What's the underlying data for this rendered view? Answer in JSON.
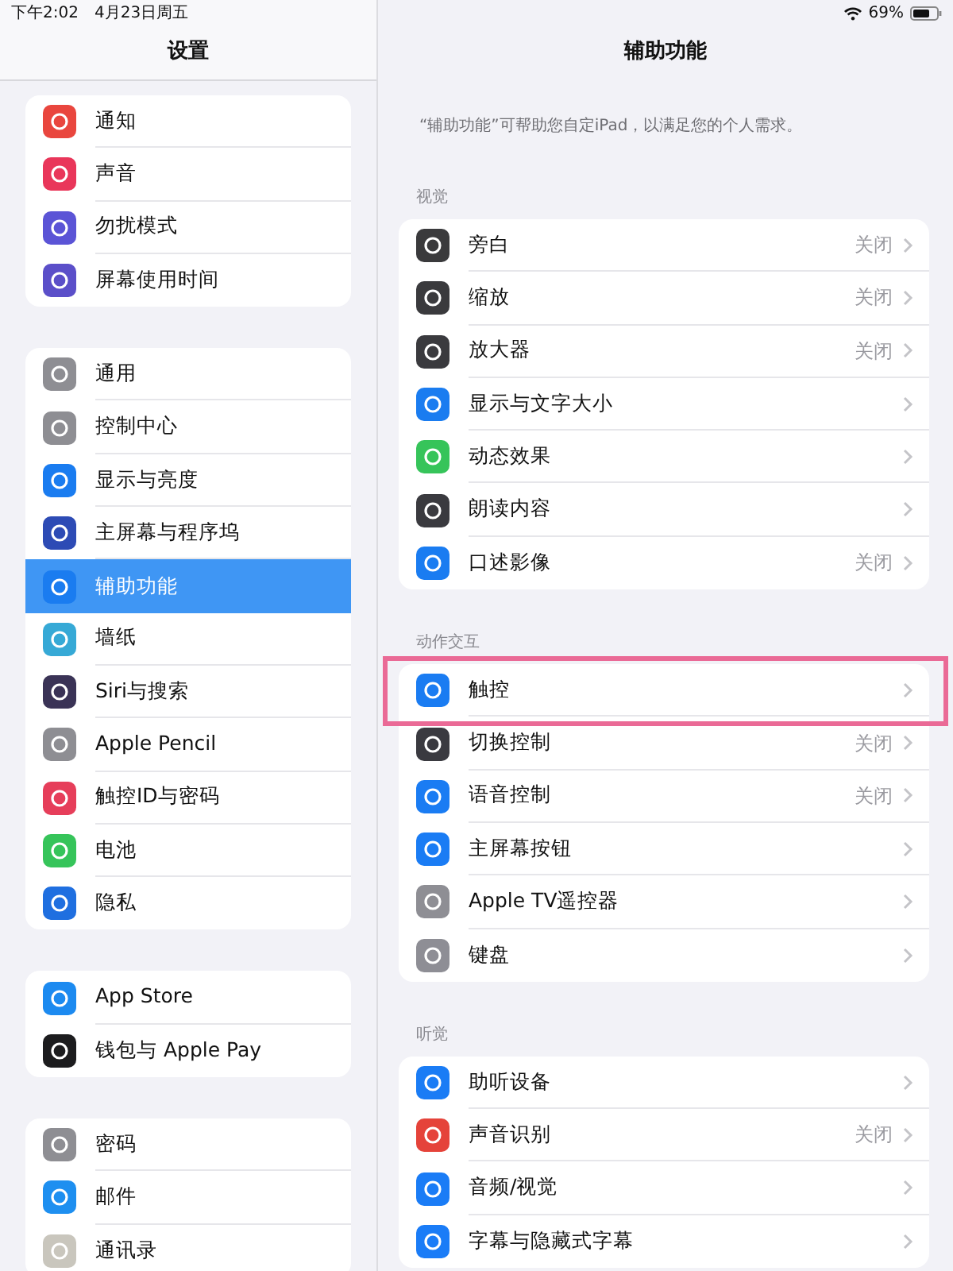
{
  "status_bar": {
    "time": "下午2:02",
    "date": "4月23日周五",
    "battery": "69%"
  },
  "sidebar": {
    "title": "设置",
    "groups": [
      {
        "items": [
          {
            "label": "通知",
            "color": "#e9463e",
            "selected": false
          },
          {
            "label": "声音",
            "color": "#e9365a",
            "selected": false
          },
          {
            "label": "勿扰模式",
            "color": "#5b54d6",
            "selected": false
          },
          {
            "label": "屏幕使用时间",
            "color": "#5b4fc9",
            "selected": false
          }
        ]
      },
      {
        "items": [
          {
            "label": "通用",
            "color": "#8e8e93",
            "selected": false
          },
          {
            "label": "控制中心",
            "color": "#8e8e93",
            "selected": false
          },
          {
            "label": "显示与亮度",
            "color": "#1a7cf0",
            "selected": false
          },
          {
            "label": "主屏幕与程序坞",
            "color": "#2d4bb5",
            "selected": false
          },
          {
            "label": "辅助功能",
            "color": "#1a7cf0",
            "selected": true
          },
          {
            "label": "墙纸",
            "color": "#36a9d6",
            "selected": false
          },
          {
            "label": "Siri与搜索",
            "color": "#3a3356",
            "selected": false
          },
          {
            "label": "Apple Pencil",
            "color": "#8e8e93",
            "selected": false
          },
          {
            "label": "触控ID与密码",
            "color": "#e63e5a",
            "selected": false
          },
          {
            "label": "电池",
            "color": "#36c45a",
            "selected": false
          },
          {
            "label": "隐私",
            "color": "#1f6fe0",
            "selected": false
          }
        ]
      },
      {
        "items": [
          {
            "label": "App Store",
            "color": "#1c8af0",
            "selected": false
          },
          {
            "label": "钱包与 Apple Pay",
            "color": "#1c1c1e",
            "selected": false
          }
        ]
      },
      {
        "items": [
          {
            "label": "密码",
            "color": "#8e8e93",
            "selected": false
          },
          {
            "label": "邮件",
            "color": "#1e8ff0",
            "selected": false
          },
          {
            "label": "通讯录",
            "color": "#c9c6bd",
            "selected": false
          }
        ]
      }
    ]
  },
  "detail": {
    "title": "辅助功能",
    "description": "“辅助功能”可帮助您自定iPad，以满足您的个人需求。",
    "sections": [
      {
        "header": "视觉",
        "items": [
          {
            "label": "旁白",
            "value": "关闭",
            "color": "#3a3a3c",
            "highlighted": false
          },
          {
            "label": "缩放",
            "value": "关闭",
            "color": "#3a3a3d",
            "highlighted": false
          },
          {
            "label": "放大器",
            "value": "关闭",
            "color": "#3a3a3e",
            "highlighted": false
          },
          {
            "label": "显示与文字大小",
            "color": "#1a7cf0",
            "highlighted": false
          },
          {
            "label": "动态效果",
            "color": "#36c45a",
            "highlighted": false
          },
          {
            "label": "朗读内容",
            "color": "#3a3a3f",
            "highlighted": false
          },
          {
            "label": "口述影像",
            "value": "关闭",
            "color": "#1a7cf1",
            "highlighted": false
          }
        ]
      },
      {
        "header": "动作交互",
        "items": [
          {
            "label": "触控",
            "color": "#1a7cf2",
            "highlighted": true
          },
          {
            "label": "切换控制",
            "value": "关闭",
            "color": "#3a3a40",
            "highlighted": false
          },
          {
            "label": "语音控制",
            "value": "关闭",
            "color": "#1a7cf3",
            "highlighted": false
          },
          {
            "label": "主屏幕按钮",
            "color": "#1a7cf4",
            "highlighted": false
          },
          {
            "label": "Apple TV遥控器",
            "color": "#8e8e94",
            "highlighted": false
          },
          {
            "label": "键盘",
            "color": "#8e8e95",
            "highlighted": false
          }
        ]
      },
      {
        "header": "听觉",
        "items": [
          {
            "label": "助听设备",
            "color": "#1a7cf5",
            "highlighted": false
          },
          {
            "label": "声音识别",
            "value": "关闭",
            "color": "#e5433a",
            "highlighted": false
          },
          {
            "label": "音频/视觉",
            "color": "#1a7cf6",
            "highlighted": false
          },
          {
            "label": "字幕与隐藏式字幕",
            "color": "#1a7cf7",
            "highlighted": false
          }
        ]
      }
    ]
  }
}
